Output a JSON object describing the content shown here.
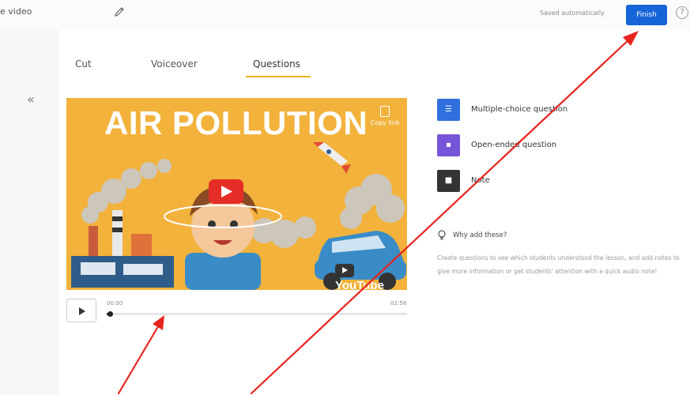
{
  "header": {
    "doc_title": "e video",
    "saved_status": "Saved automatically",
    "finish_label": "Finish",
    "help_glyph": "?"
  },
  "sidebar": {
    "collapse_glyph": "«"
  },
  "tabs": [
    {
      "label": "Cut",
      "active": false
    },
    {
      "label": "Voiceover",
      "active": false
    },
    {
      "label": "Questions",
      "active": true
    }
  ],
  "video": {
    "title": "AIR POLLUTION",
    "copy_link_label": "Copy link",
    "watermark": "YouTube",
    "current_time": "00:00",
    "duration": "02:58",
    "progress": 0.01
  },
  "options": [
    {
      "label": "Multiple-choice question",
      "icon": "list-icon",
      "color": "#2f6fde"
    },
    {
      "label": "Open-ended question",
      "icon": "chat-bubble-icon",
      "color": "#7755d8"
    },
    {
      "label": "Note",
      "icon": "note-icon",
      "color": "#333333"
    }
  ],
  "info": {
    "title": "Why add these?",
    "text": "Create questions to see which students understood the lesson, and add notes to give more information or get students' attention with a quick audio note!"
  },
  "colors": {
    "accent": "#1565d8",
    "tab_underline": "#f2b21b",
    "video_background": "#f2b23b",
    "annotation": "#e8231e"
  }
}
